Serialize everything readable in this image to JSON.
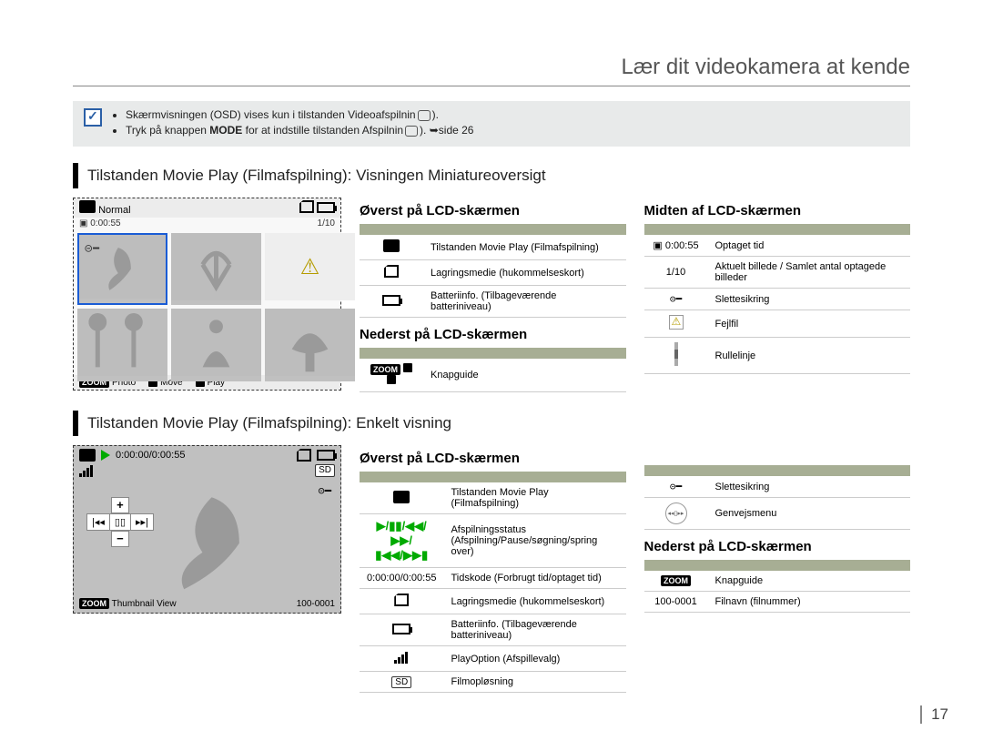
{
  "page": {
    "title": "Lær dit videokamera at kende",
    "number": "17"
  },
  "info": {
    "bullet1a": "Skærmvisningen (OSD) vises kun i tilstanden Videoafspilnin",
    "bullet1b": ").",
    "bullet2a": "Tryk på knappen ",
    "bullet2mode": "MODE",
    "bullet2b": " for at indstille tilstanden Afspilnin",
    "bullet2c": "). ",
    "bullet2ref": "side 26"
  },
  "sec1": {
    "heading": "Tilstanden Movie Play (Filmafspilning): Visningen Miniatureoversigt",
    "top": {
      "title": "Øverst på LCD-skærmen",
      "rows": [
        {
          "desc": "Tilstanden Movie Play (Filmafspilning)"
        },
        {
          "desc": "Lagringsmedie (hukommelseskort)"
        },
        {
          "desc": "Batteriinfo. (Tilbageværende batteriniveau)"
        }
      ]
    },
    "bottom": {
      "title": "Nederst på LCD-skærmen",
      "rows": [
        {
          "desc": "Knapguide"
        }
      ]
    },
    "mid": {
      "title": "Midten af LCD-skærmen",
      "rows": [
        {
          "icon": "0:00:55",
          "desc": "Optaget tid"
        },
        {
          "icon": "1/10",
          "desc": "Aktuelt billede / Samlet antal optagede billeder"
        },
        {
          "desc": "Slettesikring"
        },
        {
          "desc": "Fejlfil"
        },
        {
          "desc": "Rullelinje"
        }
      ]
    },
    "lcd": {
      "mode": "Normal",
      "time": "0:00:55",
      "count": "1/10",
      "hint_photo": "Photo",
      "hint_move": "Move",
      "hint_play": "Play",
      "zoom_label": "ZOOM"
    }
  },
  "sec2": {
    "heading": "Tilstanden Movie Play (Filmafspilning): Enkelt visning",
    "top": {
      "title": "Øverst på LCD-skærmen",
      "rows": [
        {
          "desc": "Tilstanden Movie Play (Filmafspilning)"
        },
        {
          "desc": "Afspilningsstatus (Afspilning/Pause/søgning/spring over)"
        },
        {
          "icon": "0:00:00/0:00:55",
          "desc": "Tidskode (Forbrugt tid/optaget tid)"
        },
        {
          "desc": "Lagringsmedie (hukommelseskort)"
        },
        {
          "desc": "Batteriinfo. (Tilbageværende batteriniveau)"
        },
        {
          "desc": "PlayOption (Afspillevalg)"
        },
        {
          "icon": "SD",
          "desc": "Filmopløsning"
        }
      ]
    },
    "right_top": {
      "rows": [
        {
          "desc": "Slettesikring"
        },
        {
          "desc": "Genvejsmenu"
        }
      ]
    },
    "right_bottom": {
      "title": "Nederst på LCD-skærmen",
      "rows": [
        {
          "desc": "Knapguide"
        },
        {
          "icon": "100-0001",
          "desc": "Filnavn (filnummer)"
        }
      ]
    },
    "lcd": {
      "time": "0:00:00/0:00:55",
      "sd": "SD",
      "hint_tv": "Thumbnail View",
      "filename": "100-0001",
      "zoom_label": "ZOOM"
    }
  },
  "tbl_headers": {
    "a": "",
    "b": ""
  }
}
